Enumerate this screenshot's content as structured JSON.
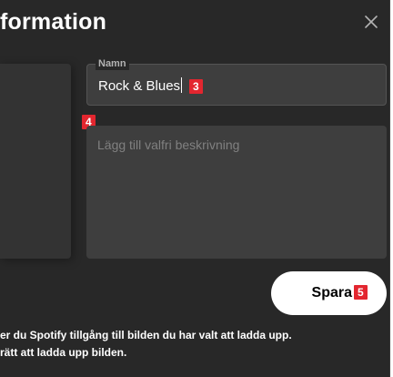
{
  "dialog": {
    "title": "formation",
    "close_icon": "close-icon"
  },
  "name_field": {
    "label": "Namn",
    "value": "Rock & Blues",
    "badge": "3"
  },
  "description_field": {
    "placeholder": "Lägg till valfri beskrivning",
    "badge": "4"
  },
  "save_button": {
    "label": "Spara",
    "badge": "5"
  },
  "disclaimer": {
    "line1": "er du Spotify tillgång till bilden du har valt att ladda upp.",
    "line2": "rätt att ladda upp bilden."
  },
  "colors": {
    "background": "#282828",
    "field": "#3e3e3e",
    "badge": "#e3262f",
    "button": "#ffffff"
  }
}
